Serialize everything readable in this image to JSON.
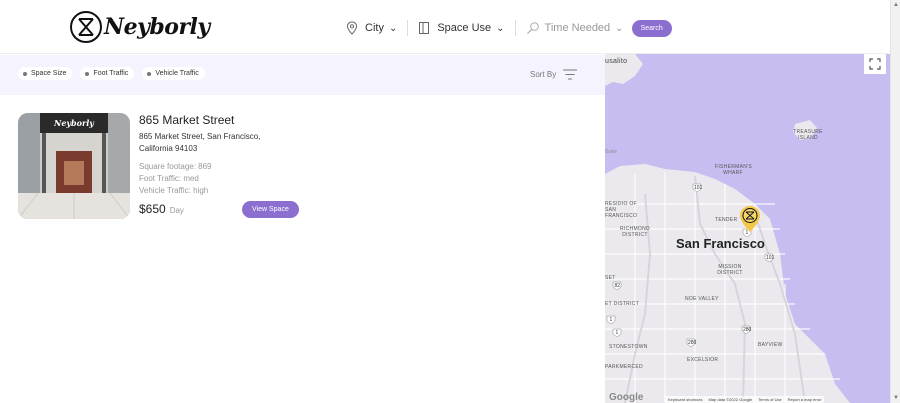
{
  "header": {
    "logo_text": "Neyborly",
    "filters": [
      {
        "label": "City",
        "icon": "map-pin-icon"
      },
      {
        "label": "Space Use",
        "icon": "building-icon"
      },
      {
        "label": "Time Needed",
        "icon": "magnifier-icon"
      }
    ],
    "search_label": "Search",
    "accent": "#8b6fd0"
  },
  "filter_bar": {
    "chips": [
      "Space Size",
      "Foot Traffic",
      "Vehicle Traffic"
    ],
    "sort_label": "Sort By"
  },
  "listings": [
    {
      "title": "865 Market Street",
      "address_line1": "865 Market Street, San Francisco,",
      "address_line2": "California 94103",
      "square_footage": "Square footage: 869",
      "foot_traffic": "Foot Traffic: med",
      "vehicle_traffic": "Vehicle Traffic: high",
      "price": "$650",
      "period": "Day",
      "view_label": "View Space",
      "thumb_sign": "Neyborly"
    }
  ],
  "map": {
    "city_label": "San Francisco",
    "labels": {
      "sausalito": "usalito",
      "treasure_island": "TREASURE ISLAND",
      "fishermans_wharf": "FISHERMAN'S WHARF",
      "presidio": "RESIDIO OF SAN FRANCISCO",
      "richmond": "RICHMOND DISTRICT",
      "tenderloin": "TENDER",
      "mission": "MISSION DISTRICT",
      "noe_valley": "NOE VALLEY",
      "sunset": "ET DISTRICT",
      "stonestown": "STONESTOWN",
      "bayview": "BAYVIEW",
      "excelsior": "EXCELSIOR",
      "parkmerced": "PARKMERCED",
      "gate": "Gate",
      "set": "SET"
    },
    "highway_shields": [
      "101",
      "1",
      "101",
      "280",
      "280",
      "1",
      "82",
      "1"
    ],
    "attribution": [
      "Keyboard shortcuts",
      "Map data ©2022 Google",
      "Terms of Use",
      "Report a map error"
    ],
    "google_text": "Google",
    "water_color": "#c7bdf1",
    "land_color": "#ebe9ee"
  }
}
